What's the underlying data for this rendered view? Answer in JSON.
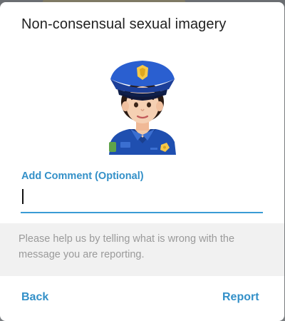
{
  "dialog": {
    "title": "Non-consensual sexual imagery",
    "sticker_icon": "police-officer-woman-icon",
    "comment_label": "Add Comment (Optional)",
    "comment_value": "",
    "comment_placeholder": "",
    "hint": "Please help us by telling what is wrong with the message you are reporting.",
    "back_label": "Back",
    "report_label": "Report"
  },
  "colors": {
    "accent": "#3390c8",
    "input_underline": "#3a9bd5",
    "hint_background": "#f1f1f1",
    "hint_text": "#9a9a9a"
  }
}
